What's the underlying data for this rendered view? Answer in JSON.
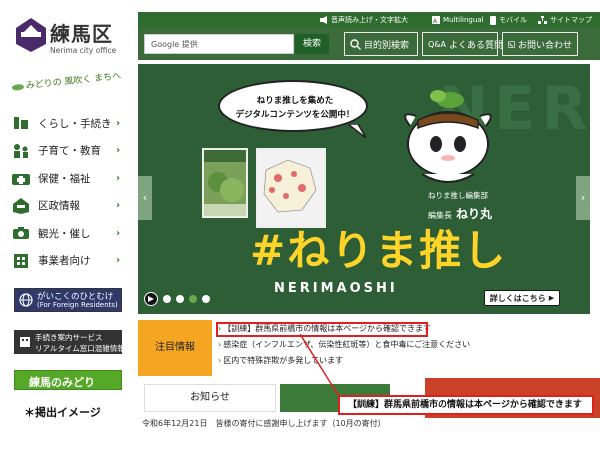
{
  "brand": {
    "name": "練馬区",
    "subtitle": "Nerima city office",
    "tagline_prefix": "みどりの",
    "tagline_mid": "風吹く",
    "tagline_suffix": "まちへ",
    "accent": "#2f6c2f"
  },
  "utility": {
    "read_aloud": "音声読み上げ・文字拡大",
    "multilingual": "Multilingual",
    "mobile": "モバイル",
    "sitemap": "サイトマップ"
  },
  "search": {
    "placeholder": "Google 提供",
    "button": "検索"
  },
  "toolbar": {
    "purpose": "目的別検索",
    "faq": "よくある質問",
    "contact": "お問い合わせ"
  },
  "nav": [
    {
      "label": "くらし・手続き",
      "icon": "house-icon"
    },
    {
      "label": "子育て・教育",
      "icon": "family-icon"
    },
    {
      "label": "保健・福祉",
      "icon": "health-icon"
    },
    {
      "label": "区政情報",
      "icon": "city-icon"
    },
    {
      "label": "観光・催し",
      "icon": "camera-icon"
    },
    {
      "label": "事業者向け",
      "icon": "building-icon"
    }
  ],
  "banners": {
    "foreign_title": "がいこくのひとむけ",
    "foreign_sub": "(For Foreign Residents)",
    "service_line1": "手続き案内サービス",
    "service_line2": "リアルタイム窓口混雑情報",
    "midori": "練馬のみどり"
  },
  "caption": "＊掲出イメージ",
  "hero": {
    "bubble_line1": "ねりま推しを集めた",
    "bubble_line2": "デジタルコンテンツを公開中！",
    "bg_text": "NERIMA",
    "hashtag": "#ねりま推し",
    "romaji": "NERIMAOSHI",
    "editor_dept": "ねりま推し編集部",
    "editor_title": "編集長",
    "editor_name": "ねり丸",
    "detail_button": "詳しくはこちら",
    "slide_count": 4,
    "active_slide": 3
  },
  "notices": {
    "heading": "注目情報",
    "items": [
      "【訓練】群馬県前橋市の情報は本ページから確認できます",
      "感染症（インフルエンザ、伝染性紅斑等）と食中毒にご注意ください",
      "区内で特殊詐欺が多発しています"
    ]
  },
  "tabs": {
    "oshirase": "お知らせ"
  },
  "news": {
    "date": "令和6年12月21日",
    "text": "皆様の寄付に感謝申し上げます（10月の寄付）"
  },
  "callout": "【訓練】群馬県前橋市の情報は本ページから確認できます"
}
